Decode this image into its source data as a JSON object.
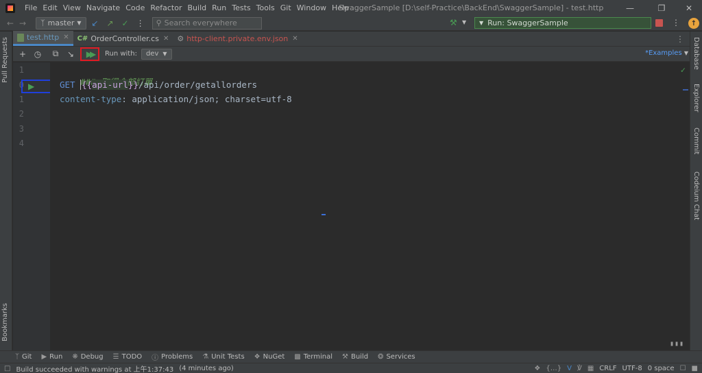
{
  "menubar": {
    "items": [
      "File",
      "Edit",
      "View",
      "Navigate",
      "Code",
      "Refactor",
      "Build",
      "Run",
      "Tests",
      "Tools",
      "Git",
      "Window",
      "Help"
    ],
    "window_title": "SwaggerSample [D:\\self-Practice\\BackEnd\\SwaggerSample] - test.http"
  },
  "navbar": {
    "branch": "master",
    "search_placeholder": "Search everywhere",
    "run_config": "Run: SwaggerSample"
  },
  "left_strip": {
    "pull_requests": "Pull Requests",
    "bookmarks": "Bookmarks"
  },
  "right_strip": {
    "database": "Database",
    "explorer": "Explorer",
    "commit": "Commit",
    "codeium": "Codeium Chat"
  },
  "tabs": [
    {
      "label": "test.http",
      "active": true
    },
    {
      "label": "OrderController.cs",
      "prefix": "C#",
      "active": false
    },
    {
      "label": "http-client.private.env.json",
      "active": false
    }
  ],
  "editor_toolbar": {
    "run_with_label": "Run with:",
    "env": "dev",
    "examples_link": "*Examples"
  },
  "gutter": {
    "line_numbers": [
      "1",
      "0",
      "1",
      "2",
      "3",
      "4"
    ]
  },
  "code": {
    "comment": "### 取得全部訂單",
    "method": "GET",
    "var_open": "{{",
    "var_name": "api-url",
    "var_close": "}}",
    "path": "/api/order/getallorders",
    "header_name": "content-type",
    "header_sep": ": ",
    "header_value": "application/json; charset=utf-8"
  },
  "tool_windows": [
    "Git",
    "Run",
    "Debug",
    "TODO",
    "Problems",
    "Unit Tests",
    "NuGet",
    "Terminal",
    "Build",
    "Services"
  ],
  "statusbar": {
    "message": "Build succeeded with warnings at 上午1:37:43",
    "age": "(4 minutes ago)",
    "line_ending": "CRLF",
    "encoding": "UTF-8",
    "indent": "0 space"
  },
  "colors": {
    "accent": "#4a88c7",
    "run_green": "#499c54",
    "highlight_red": "#e01b24",
    "highlight_blue": "#1f3fdc"
  }
}
